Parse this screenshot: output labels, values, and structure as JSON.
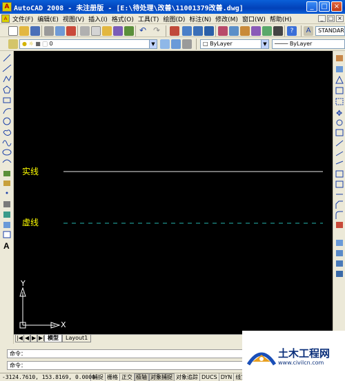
{
  "window": {
    "title": "AutoCAD 2008 - 未注册版 - [E:\\待处理\\改善\\11001379改善.dwg]",
    "app_icon": "autocad-logo-icon",
    "buttons": [
      "_",
      "□",
      "×"
    ]
  },
  "menubar": {
    "items": [
      "文件(F)",
      "编辑(E)",
      "视图(V)",
      "插入(I)",
      "格式(O)",
      "工具(T)",
      "绘图(D)",
      "标注(N)",
      "修改(M)",
      "窗口(W)",
      "帮助(H)"
    ],
    "doc_buttons": [
      "_",
      "□",
      "×"
    ]
  },
  "toolbar_standard": {
    "text_style_combo": "STANDARD"
  },
  "toolbar_layers": {
    "layer_combo": "0",
    "color_combo": "ByLayer",
    "linetype_combo": "ByLayer"
  },
  "canvas": {
    "background": "#000000",
    "label_color": "#ffff00",
    "labels": {
      "solid_line": "实线",
      "dashed_line": "虚线"
    },
    "ucs": {
      "x_label": "X",
      "y_label": "Y"
    }
  },
  "tabs": {
    "nav": [
      "|◀",
      "◀",
      "▶",
      "▶|"
    ],
    "items": [
      "模型",
      "Layout1"
    ],
    "active": "模型"
  },
  "command": {
    "line1": "命令：",
    "line2": "命令："
  },
  "statusbar": {
    "coords": "-3124.7610, 153.8169, 0.0000",
    "buttons": [
      "捕捉",
      "栅格",
      "正交",
      "极轴",
      "对象捕捉",
      "对象追踪",
      "DUCS",
      "DYN",
      "线宽"
    ]
  },
  "watermark": {
    "title": "土木工程网",
    "url": "www.civilcn.com"
  }
}
